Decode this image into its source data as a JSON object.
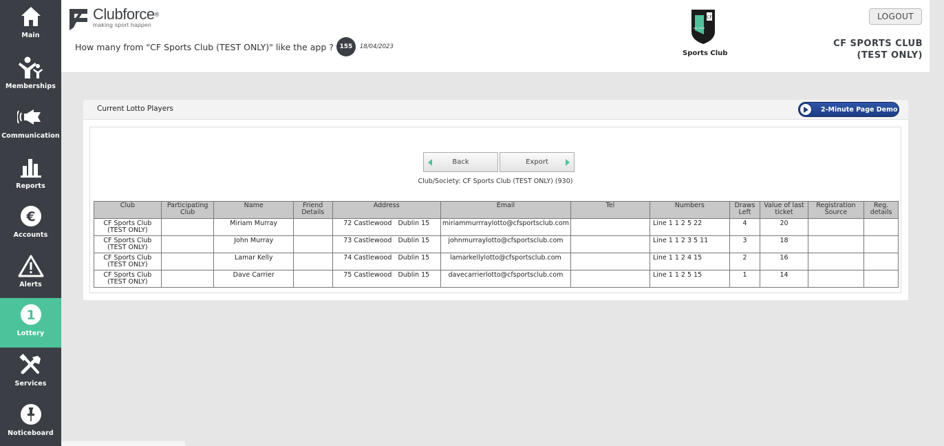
{
  "sidebar": {
    "items": [
      {
        "label": "Main",
        "icon": "home-icon"
      },
      {
        "label": "Memberships",
        "icon": "people-icon"
      },
      {
        "label": "Communication",
        "icon": "megaphone-icon"
      },
      {
        "label": "Reports",
        "icon": "bar-chart-icon"
      },
      {
        "label": "Accounts",
        "icon": "euro-icon"
      },
      {
        "label": "Alerts",
        "icon": "warning-icon"
      },
      {
        "label": "Lottery",
        "icon": "lottery-icon",
        "badge": "1",
        "active": true
      },
      {
        "label": "Services",
        "icon": "tools-icon"
      },
      {
        "label": "Noticeboard",
        "icon": "pin-icon"
      }
    ],
    "active_color": "#4cc39a"
  },
  "header": {
    "brand_name": "Clubforce",
    "brand_mark": "®",
    "brand_tagline": "making sport happen",
    "likes_question": "How many from \"CF Sports Club (TEST ONLY)\" like the app ?",
    "likes_count": "155",
    "likes_date": "18/04/2023",
    "crest_name": "Sports Club",
    "logout_label": "LOGOUT",
    "club_title_line1": "CF SPORTS CLUB",
    "club_title_line2": "(TEST ONLY)"
  },
  "panel": {
    "title": "Current Lotto Players",
    "demo_label": "2-Minute Page Demo",
    "back_label": "Back",
    "export_label": "Export",
    "club_line": "Club/Society: CF Sports Club (TEST ONLY) (930)"
  },
  "table": {
    "columns": [
      "Club",
      "Participating Club",
      "Name",
      "Friend Details",
      "Address",
      "Email",
      "Tel",
      "Numbers",
      "Draws Left",
      "Value of last ticket",
      "Registration Source",
      "Reg. details"
    ],
    "rows": [
      {
        "club": "CF Sports Club (TEST ONLY)",
        "participating": "",
        "name": "Miriam Murray",
        "friend": "",
        "address": "72 Castlewood   Dublin 15",
        "email": "miriammurrraylotto@cfsportsclub.com",
        "tel": "",
        "numbers": "Line 1 1 2 5 22",
        "draws": "4",
        "value": "20",
        "source": "",
        "reg": ""
      },
      {
        "club": "CF Sports Club (TEST ONLY)",
        "participating": "",
        "name": "John Murray",
        "friend": "",
        "address": "73 Castlewood   Dublin 15",
        "email": "johnmurraylotto@cfsportsclub.com",
        "tel": "",
        "numbers": "Line 1 1 2 3 5 11",
        "draws": "3",
        "value": "18",
        "source": "",
        "reg": ""
      },
      {
        "club": "CF Sports Club (TEST ONLY)",
        "participating": "",
        "name": "Lamar Kelly",
        "friend": "",
        "address": "74 Castlewood   Dublin 15",
        "email": "lamarkellylotto@cfsportsclub.com",
        "tel": "",
        "numbers": "Line 1 1 2 4 15",
        "draws": "2",
        "value": "16",
        "source": "",
        "reg": ""
      },
      {
        "club": "CF Sports Club (TEST ONLY)",
        "participating": "",
        "name": "Dave Carrier",
        "friend": "",
        "address": "75 Castlewood   Dublin 15",
        "email": "davecarrierlotto@cfsportsclub.com",
        "tel": "",
        "numbers": "Line 1 1 2 5 15",
        "draws": "1",
        "value": "14",
        "source": "",
        "reg": ""
      }
    ]
  }
}
